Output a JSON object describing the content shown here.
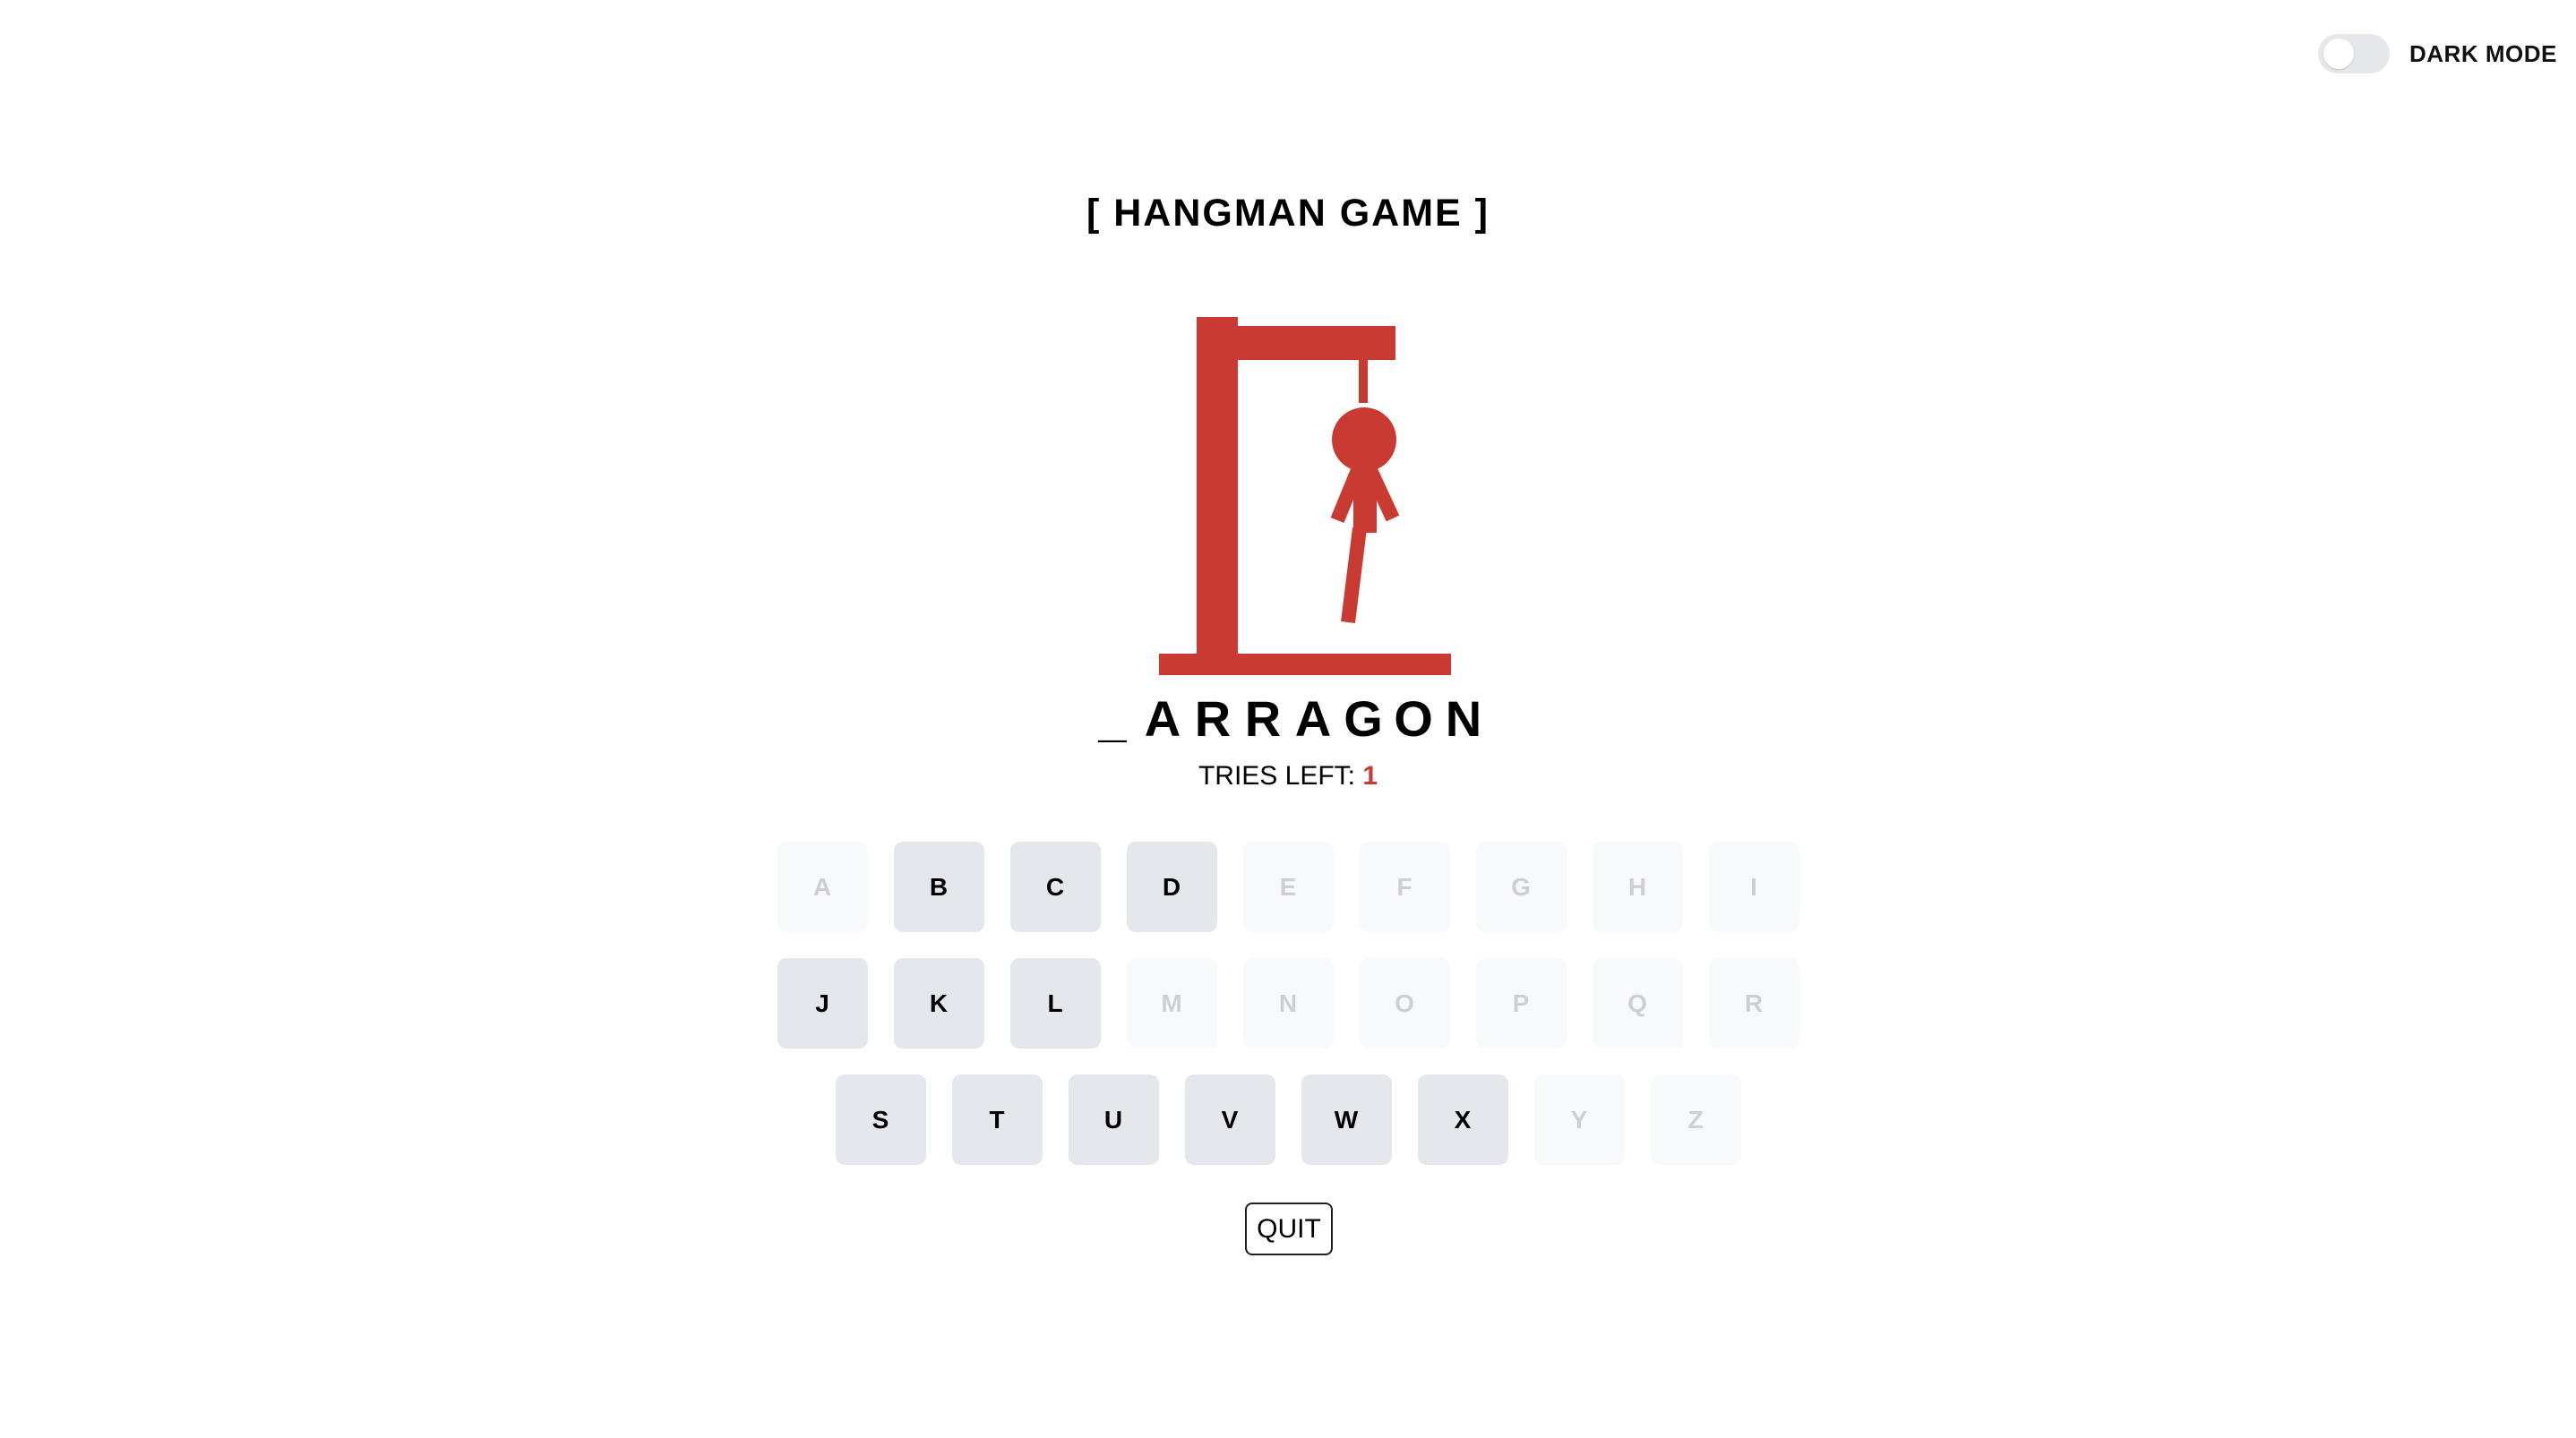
{
  "settings": {
    "dark_mode_label": "DARK MODE",
    "dark_mode_on": false
  },
  "game": {
    "title": "[ HANGMAN GAME ]",
    "word_display": [
      "_",
      "A",
      "R",
      "R",
      "A",
      "G",
      "O",
      "N"
    ],
    "tries_label": "TRIES LEFT:",
    "tries_left": "1",
    "quit_label": "QUIT"
  },
  "colors": {
    "gallows": "#c93a32",
    "accent": "#c93a32",
    "key_active_bg": "#e4e7ec",
    "key_used_bg": "#f8f9fb"
  },
  "keyboard": {
    "rows": [
      [
        {
          "letter": "A",
          "used": true
        },
        {
          "letter": "B",
          "used": false
        },
        {
          "letter": "C",
          "used": false
        },
        {
          "letter": "D",
          "used": false
        },
        {
          "letter": "E",
          "used": true
        },
        {
          "letter": "F",
          "used": true
        },
        {
          "letter": "G",
          "used": true
        },
        {
          "letter": "H",
          "used": true
        },
        {
          "letter": "I",
          "used": true
        }
      ],
      [
        {
          "letter": "J",
          "used": false
        },
        {
          "letter": "K",
          "used": false
        },
        {
          "letter": "L",
          "used": false
        },
        {
          "letter": "M",
          "used": true
        },
        {
          "letter": "N",
          "used": true
        },
        {
          "letter": "O",
          "used": true
        },
        {
          "letter": "P",
          "used": true
        },
        {
          "letter": "Q",
          "used": true
        },
        {
          "letter": "R",
          "used": true
        }
      ],
      [
        {
          "letter": "S",
          "used": false
        },
        {
          "letter": "T",
          "used": false
        },
        {
          "letter": "U",
          "used": false
        },
        {
          "letter": "V",
          "used": false
        },
        {
          "letter": "W",
          "used": false
        },
        {
          "letter": "X",
          "used": false
        },
        {
          "letter": "Y",
          "used": true
        },
        {
          "letter": "Z",
          "used": true
        }
      ]
    ]
  }
}
